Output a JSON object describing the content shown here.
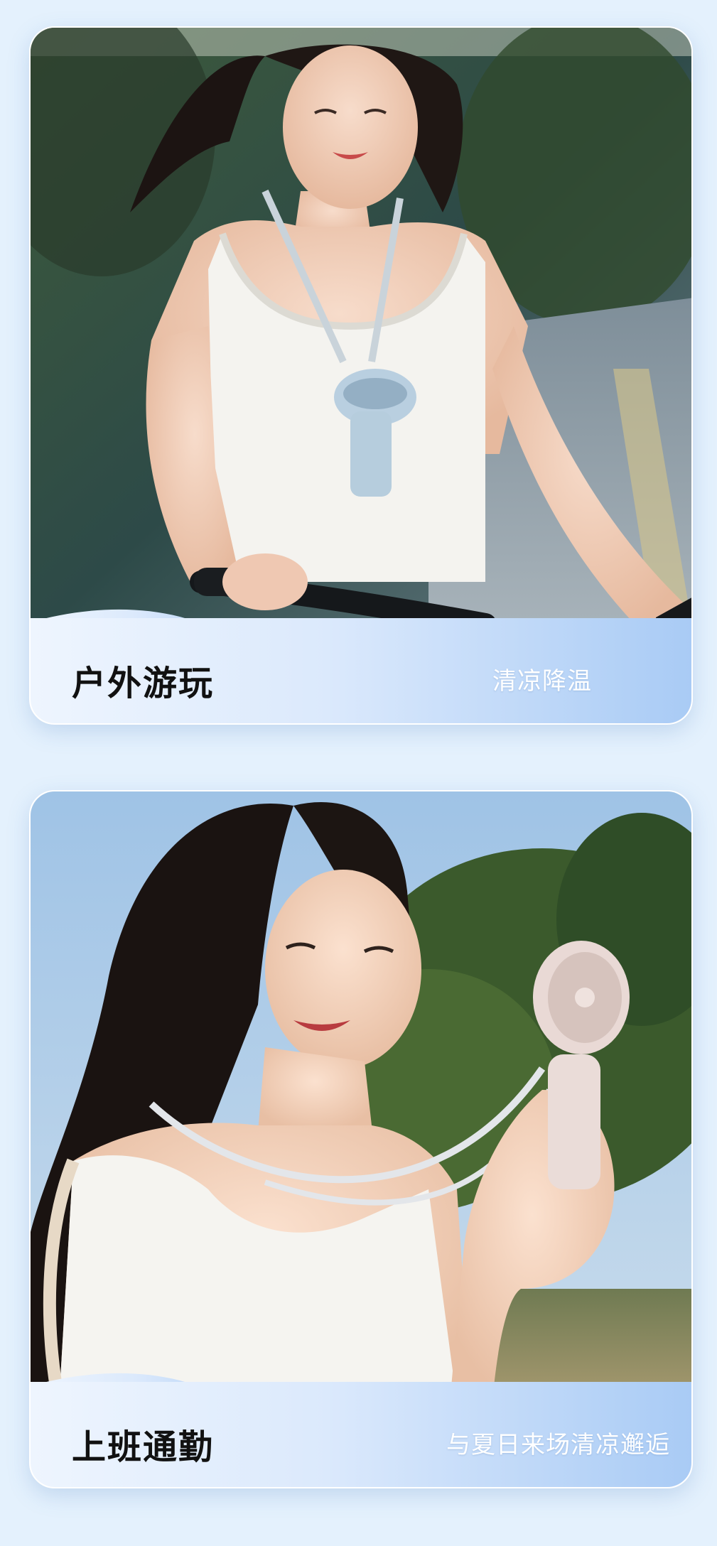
{
  "cards": [
    {
      "title": "户外游玩",
      "subtitle": "清凉降温"
    },
    {
      "title": "上班通勤",
      "subtitle": "与夏日来场清凉邂逅"
    }
  ],
  "colors": {
    "page_background": "#e4f1fd",
    "caption_gradient_start": "#eef5fe",
    "caption_gradient_end": "#a9cbf5",
    "title_color": "#111111",
    "subtitle_color": "#ffffff"
  }
}
